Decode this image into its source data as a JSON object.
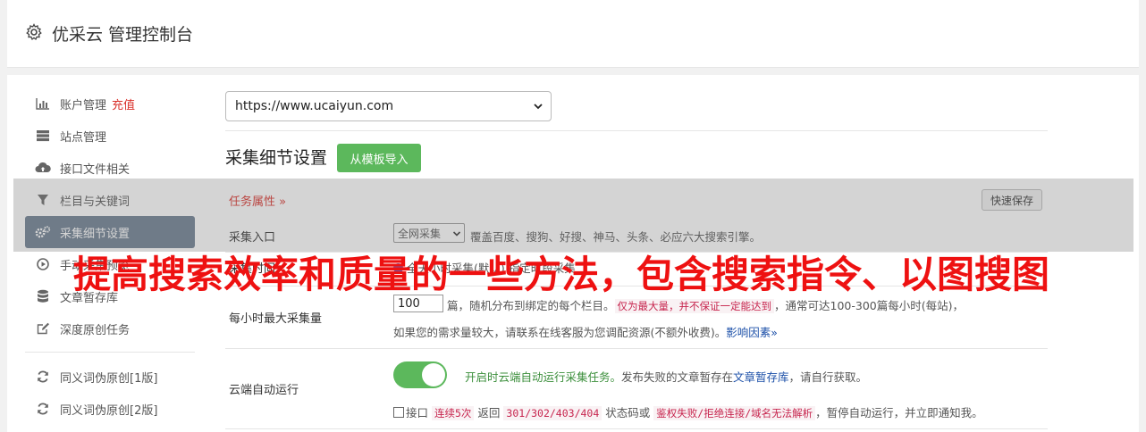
{
  "header": {
    "title": "优采云 管理控制台",
    "icon": "gear-icon"
  },
  "sidebar": {
    "items": [
      {
        "label": "账户管理",
        "extra": "充值",
        "icon": "bar-chart-icon"
      },
      {
        "label": "站点管理",
        "icon": "server-icon"
      },
      {
        "label": "接口文件相关",
        "icon": "cloud-upload-icon"
      },
      {
        "label": "栏目与关键词",
        "icon": "filter-icon"
      },
      {
        "label": "采集细节设置",
        "icon": "cogs-icon",
        "active": true
      },
      {
        "label": "手动采集预览",
        "icon": "play-circle-icon"
      },
      {
        "label": "文章暂存库",
        "icon": "database-icon"
      },
      {
        "label": "深度原创任务",
        "icon": "edit-icon"
      },
      {
        "label": "同义词伪原创[1版]",
        "icon": "refresh-icon"
      },
      {
        "label": "同义词伪原创[2版]",
        "icon": "refresh-icon"
      }
    ]
  },
  "site_select": {
    "value": "https://www.ucaiyun.com"
  },
  "section": {
    "title": "采集细节设置",
    "template_button": "从模板导入"
  },
  "task_attr": {
    "label": "任务属性 »",
    "save_button": "快速保存"
  },
  "entry": {
    "label": "采集入口",
    "select_value": "全网采集",
    "desc": "覆盖百度、搜狗、好搜、神马、头条、必应六大搜索引擎。"
  },
  "time_row": {
    "label": "采集时间",
    "option1": "全天小时采集(默认)",
    "option2": "指定时段采集"
  },
  "hourly": {
    "label": "每小时最大采集量",
    "value": "100",
    "text1": "篇，随机分布到绑定的每个栏目。",
    "tag1": "仅为最大量，并不保证一定能达到",
    "text2": "，通常可达100-300篇每小时(每站)，",
    "text3": "如果您的需求量较大，请联系在线客服为您调配资源(不额外收费)。",
    "link": "影响因素»"
  },
  "cloud": {
    "label": "云端自动运行",
    "toggle_on": true,
    "text_green": "开启时云端自动运行采集任务。",
    "text1": "发布失败的文章暂存在",
    "link": "文章暂存库",
    "text2": "，请自行获取。",
    "chk_label": "接口",
    "tag1": "连续5次",
    "text3": "返回",
    "tag2": "301/302/403/404",
    "text4": "状态码或",
    "tag3": "鉴权失败/拒绝连接/域名无法解析",
    "text5": "，暂停自动运行，并立即通知我。"
  },
  "overlay_caption": "提高搜索效率和质量的一些方法，包含搜索指令、以图搜图",
  "colors": {
    "accent_green": "#5cb85c",
    "active_nav": "#6b7c8f",
    "red": "#d9302a",
    "caption_red": "#ee1111"
  }
}
